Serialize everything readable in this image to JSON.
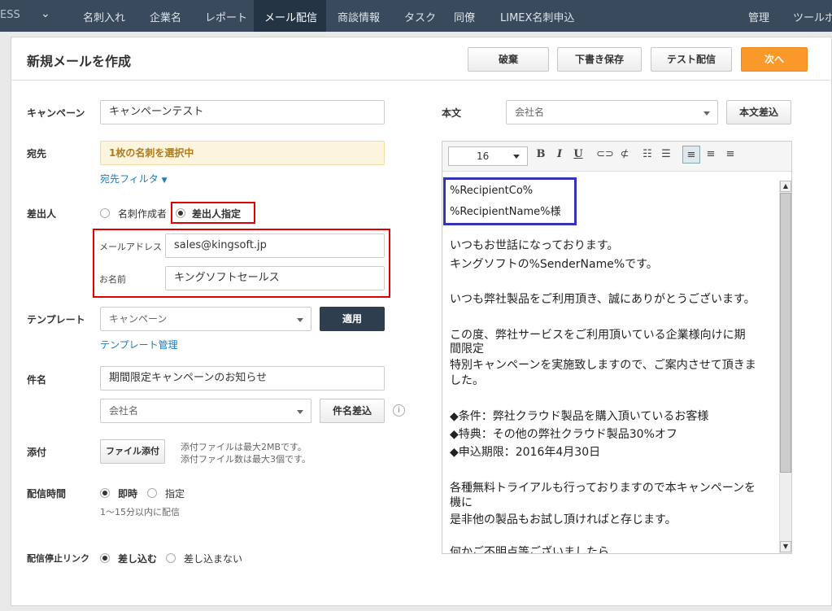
{
  "nav": {
    "brand": "ESS",
    "items": [
      "名刺入れ",
      "企業名",
      "レポート",
      "メール配信",
      "商談情報",
      "タスク",
      "同僚",
      "LIMEX名刺申込"
    ],
    "right_items": [
      "管理",
      "ツールボ"
    ]
  },
  "header": {
    "title": "新規メールを作成",
    "discard": "破棄",
    "save_draft": "下書き保存",
    "test_send": "テスト配信",
    "next": "次へ"
  },
  "form": {
    "campaign_label": "キャンペーン",
    "campaign_value": "キャンペーンテスト",
    "to_label": "宛先",
    "to_value": "1枚の名刺を選択中",
    "to_filter": "宛先フィルタ",
    "sender_label": "差出人",
    "sender_opt1": "名刺作成者",
    "sender_opt2": "差出人指定",
    "email_label": "メールアドレス",
    "email_value": "sales@kingsoft.jp",
    "name_label": "お名前",
    "name_value": "キングソフトセールス",
    "template_label": "テンプレート",
    "template_value": "キャンペーン",
    "apply": "適用",
    "template_manage": "テンプレート管理",
    "subject_label": "件名",
    "subject_value": "期間限定キャンペーンのお知らせ",
    "subject_insert_select": "会社名",
    "subject_insert_btn": "件名差込",
    "attach_label": "添付",
    "attach_btn": "ファイル添付",
    "attach_note1": "添付ファイルは最大2MBです。",
    "attach_note2": "添付ファイル数は最大3個です。",
    "time_label": "配信時間",
    "time_opt1": "即時",
    "time_opt2": "指定",
    "time_note": "1〜15分以内に配信",
    "stop_label": "配信停止リンク",
    "stop_opt1": "差し込む",
    "stop_opt2": "差し込まない"
  },
  "body": {
    "label": "本文",
    "insert_select": "会社名",
    "insert_btn": "本文差込",
    "font_size": "16",
    "toolbar_icons": [
      "bold-icon",
      "italic-icon",
      "underline-icon",
      "link-icon",
      "unlink-icon",
      "ordered-list-icon",
      "bullet-list-icon",
      "align-left-icon",
      "align-center-icon",
      "align-right-icon"
    ],
    "lines": [
      "%RecipientCo%",
      "%RecipientName%様",
      "いつもお世話になっております。",
      "キングソフトの%SenderName%です。",
      "いつも弊社製品をご利用頂き、誠にありがとうございます。",
      "この度、弊社サービスをご利用頂いている企業様向けに期",
      "間限定",
      "特別キャンペーンを実施致しますので、ご案内させて頂きま",
      "した。",
      "◆条件：弊社クラウド製品を購入頂いているお客様",
      "◆特典：その他の弊社クラウド製品30%オフ",
      "◆申込期限：2016年4月30日",
      "各種無料トライアルも行っておりますので本キャンペーンを",
      "機に",
      "是非他の製品もお試し頂ければと存じます。",
      "何かご不明点等ございましたら"
    ]
  },
  "colors": {
    "nav_bg": "#384a5c",
    "accent_orange": "#f9982b",
    "highlight_red": "#e00000",
    "highlight_blue": "#3333bb",
    "link_blue": "#1d7bbf"
  }
}
